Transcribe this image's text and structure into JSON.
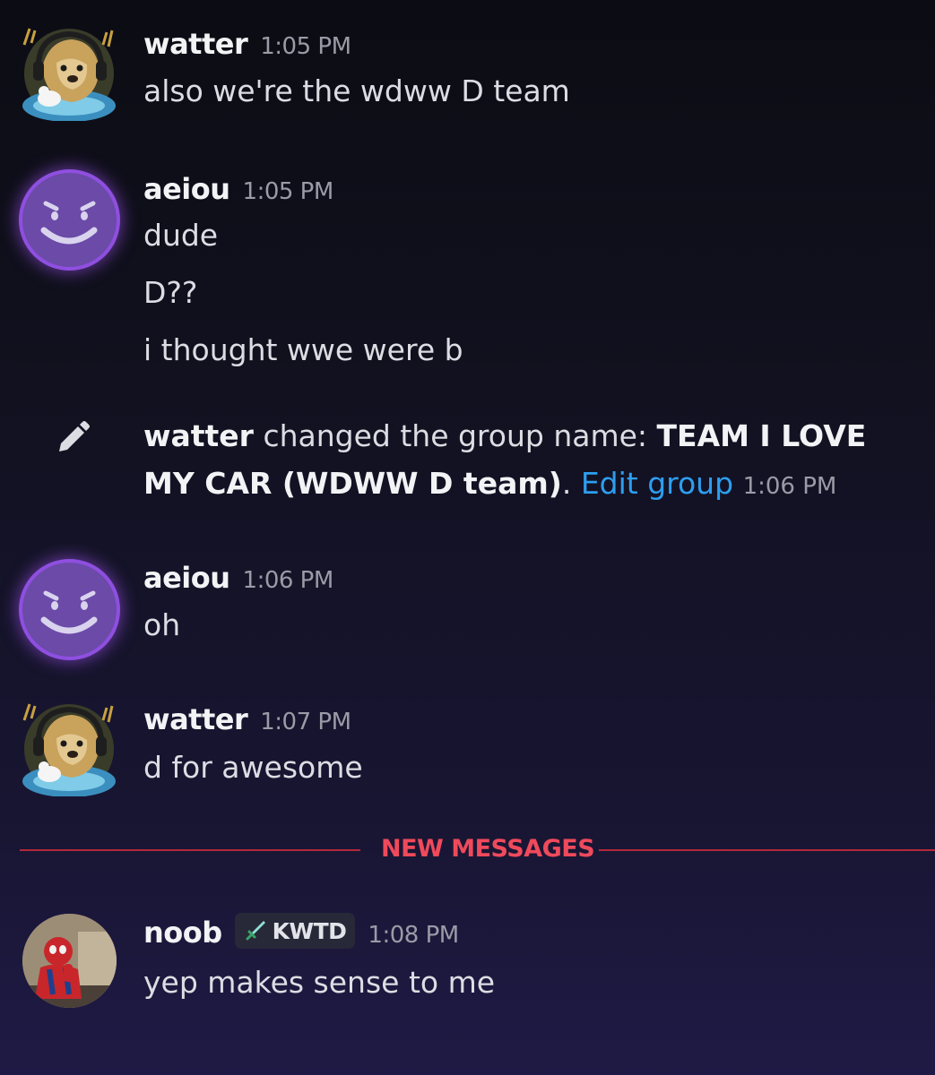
{
  "messages": [
    {
      "author": "watter",
      "time": "1:05 PM",
      "lines": [
        "also we're the wdww D team"
      ]
    },
    {
      "author": "aeiou",
      "time": "1:05 PM",
      "lines": [
        "dude",
        "D??",
        "i thought wwe were b"
      ]
    },
    {
      "author": "aeiou",
      "time": "1:06 PM",
      "lines": [
        "oh"
      ]
    },
    {
      "author": "watter",
      "time": "1:07 PM",
      "lines": [
        "d for awesome"
      ]
    },
    {
      "author": "noob",
      "tag": "KWTD",
      "time": "1:08 PM",
      "lines": [
        "yep makes sense to me"
      ]
    }
  ],
  "system_message": {
    "icon": "pencil-icon",
    "actor": "watter",
    "action": " changed the group name: ",
    "new_name": "TEAM I LOVE MY CAR (WDWW D team)",
    "period": ". ",
    "link": "Edit group",
    "time": "1:06 PM"
  },
  "divider": {
    "label": "NEW MESSAGES",
    "color": "#ef4a5b"
  },
  "colors": {
    "link": "#2d9ff0",
    "avatar_purple": "#6b4aa8"
  }
}
